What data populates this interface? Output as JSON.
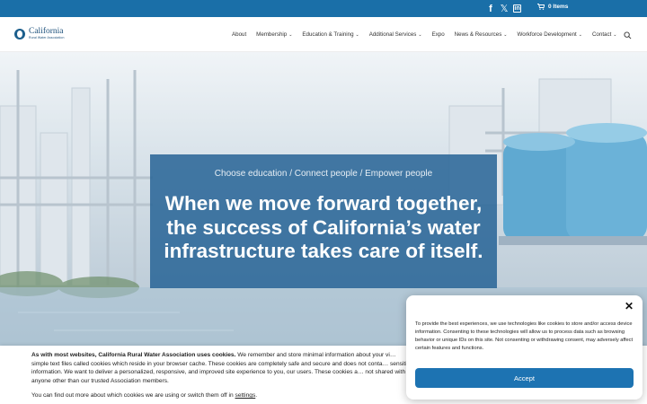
{
  "topbar": {
    "social": [
      "facebook-icon",
      "x-twitter-icon",
      "linkedin-icon"
    ],
    "cart_label": "0 Items"
  },
  "header": {
    "logo": {
      "name": "California",
      "sub": "Rural Water Association"
    },
    "nav": [
      {
        "label": "About",
        "dropdown": false
      },
      {
        "label": "Membership",
        "dropdown": true
      },
      {
        "label": "Education & Training",
        "dropdown": true
      },
      {
        "label": "Additional Services",
        "dropdown": true
      },
      {
        "label": "Expo",
        "dropdown": false
      },
      {
        "label": "News & Resources",
        "dropdown": true
      },
      {
        "label": "Workforce Development",
        "dropdown": true
      },
      {
        "label": "Contact",
        "dropdown": true
      }
    ]
  },
  "hero": {
    "tagline": "Choose education / Connect people / Empower people",
    "headline": "When we move forward together, the success of California’s water infrastructure takes care of itself."
  },
  "cookie_bar": {
    "bold": "As with most websites, California Rural Water Association uses cookies.",
    "body": " We remember and store minimal information about your vi… simple text files called cookies which reside in your browser cache. These cookies are completely safe and secure and does not conta… sensitive information. We want to deliver a personalized, responsive, and improved site experience to you, our users. These cookies a… not shared with anyone other than our trusted Association members.",
    "line2_prefix": "You can find out more about which cookies we are using or switch them off in ",
    "settings_link": "settings",
    "line2_suffix": "."
  },
  "consent_modal": {
    "text": "To provide the best experiences, we use technologies like cookies to store and/or access device information. Consenting to these technologies will allow us to process data such as browsing behavior or unique IDs on this site. Not consenting or withdrawing consent, may adversely affect certain features and functions.",
    "accept_label": "Accept",
    "close_symbol": "✕"
  },
  "colors": {
    "topbar": "#1a6fa8",
    "hero_box": "#2864a0",
    "accept_button": "#1d73b2"
  }
}
